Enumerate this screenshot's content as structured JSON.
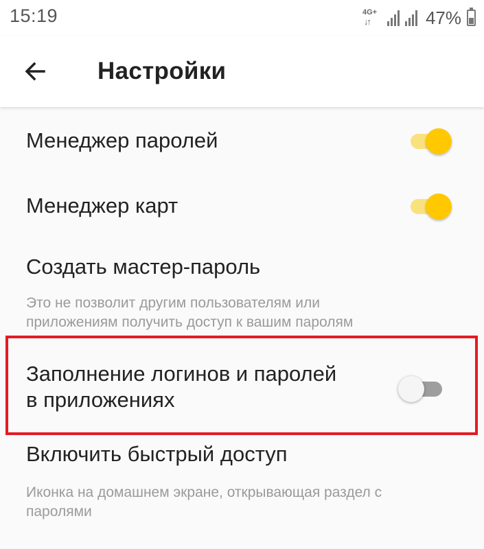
{
  "status_bar": {
    "time": "15:19",
    "network": "4G+",
    "network_arrows": "↓↑",
    "battery_percent": "47%",
    "icons": [
      "network-4g-icon",
      "signal-icon",
      "signal-icon",
      "battery-icon"
    ]
  },
  "app_bar": {
    "back_icon": "arrow-left-icon",
    "title": "Настройки"
  },
  "settings": [
    {
      "title": "Менеджер паролей",
      "description": "",
      "toggle": true
    },
    {
      "title": "Менеджер карт",
      "description": "",
      "toggle": true
    },
    {
      "title": "Создать мастер-пароль",
      "description_line1": "Это не позволит другим пользователям или",
      "description_line2": "приложениям получить доступ к вашим паролям"
    },
    {
      "title_line1": "Заполнение логинов и паролей",
      "title_line2": "в приложениях",
      "toggle": false,
      "highlighted": true
    },
    {
      "title": "Включить быстрый доступ",
      "description_line1": "Иконка на домашнем экране, открывающая раздел с",
      "description_line2": "паролями"
    }
  ],
  "colors": {
    "toggle_on_thumb": "#ffc800",
    "toggle_on_track": "#f9e27d",
    "toggle_off_track": "#9e9e9e",
    "highlight_border": "#e31c23"
  }
}
